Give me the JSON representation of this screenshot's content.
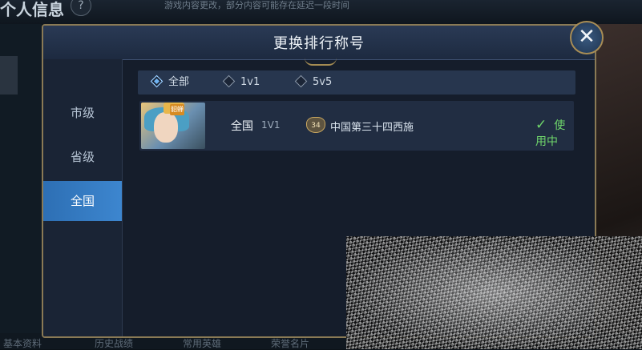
{
  "background": {
    "title": "个人信息",
    "help": "?",
    "notice": "游戏内容更改，部分内容可能存在延迟一段时间",
    "bottom_tabs": [
      "基本资料",
      "历史战绩",
      "常用英雄",
      "荣誉名片"
    ]
  },
  "dialog": {
    "title": "更换排行称号",
    "close": "✕",
    "sidebar": [
      {
        "label": "市级",
        "active": false
      },
      {
        "label": "省级",
        "active": false
      },
      {
        "label": "全国",
        "active": true
      }
    ],
    "filters": [
      {
        "label": "全部",
        "active": true
      },
      {
        "label": "1v1",
        "active": false
      },
      {
        "label": "5v5",
        "active": false
      }
    ],
    "rows": [
      {
        "portrait_tag": "貂蝉",
        "scope": "全国",
        "mode": "1V1",
        "rank": "34",
        "title": "中国第三十四西施",
        "status": "使用中",
        "status_icon": "✓"
      }
    ]
  },
  "colors": {
    "accent_blue": "#3d86cf",
    "frame_gold": "#8a7a55",
    "status_green": "#6fd66b"
  }
}
